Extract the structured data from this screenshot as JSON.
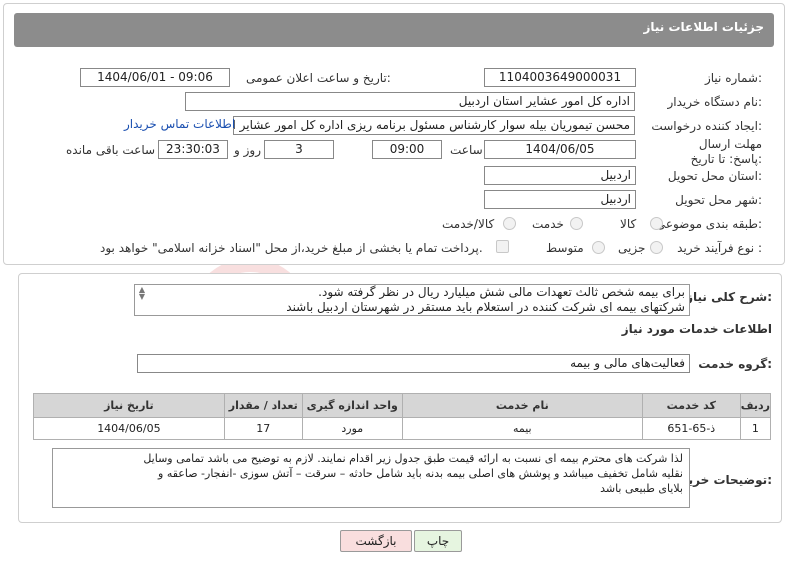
{
  "header": {
    "title": "جزئیات اطلاعات نیاز"
  },
  "fields": {
    "need_number_label": "شماره نیاز:",
    "need_number": "1104003649000031",
    "announce_label": "تاریخ و ساعت اعلان عمومی:",
    "announce_value": "1404/06/01 - 09:06",
    "buyer_org_label": "نام دستگاه خریدار:",
    "buyer_org": "اداره کل امور عشایر استان اردبیل",
    "creator_label": "ایجاد کننده درخواست:",
    "creator": "محسن تیموریان بیله سوار کارشناس مسئول برنامه ریزی اداره کل امور عشایر اس",
    "contact_link": "اطلاعات تماس خریدار",
    "deadline_label": "مهلت ارسال پاسخ: تا تاریخ:",
    "deadline_date": "1404/06/05",
    "time_label": "ساعت",
    "deadline_time": "09:00",
    "days_value": "3",
    "days_label": "روز و",
    "remaining_time": "23:30:03",
    "remaining_label": "ساعت باقی مانده",
    "province_label": "استان محل تحویل:",
    "province": "اردبیل",
    "city_label": "شهر محل تحویل:",
    "city": "اردبیل",
    "category_label": "طبقه بندی موضوعی:",
    "category_options": [
      "کالا",
      "خدمت",
      "کالا/خدمت"
    ],
    "category_selected": "خدمت",
    "process_label": "نوع فرآیند خرید :",
    "process_options": [
      "جزیی",
      "متوسط"
    ],
    "process_selected": "جزیی",
    "payment_note": "پرداخت تمام یا بخشی از مبلغ خرید،از محل \"اسناد خزانه اسلامی\" خواهد بود."
  },
  "description": {
    "label": "شرح کلی نیاز:",
    "line1": "برای بیمه شخص ثالث تعهدات مالی شش میلیارد ریال در نظر گرفته شود.",
    "line2": "شرکتهای بیمه ای شرکت کننده در استعلام باید مستقر در شهرستان اردبیل باشند"
  },
  "services": {
    "section_title": "اطلاعات خدمات مورد نیاز",
    "group_label": "گروه خدمت:",
    "group_value": "فعالیت‌های مالی و بیمه",
    "columns": [
      "ردیف",
      "کد خدمت",
      "نام خدمت",
      "واحد اندازه گیری",
      "تعداد / مقدار",
      "تاریخ نیاز"
    ],
    "rows": [
      {
        "row": "1",
        "code": "ذ-65-651",
        "name": "بیمه",
        "unit": "مورد",
        "qty": "17",
        "date": "1404/06/05"
      }
    ]
  },
  "buyer_notes": {
    "label": "توضیحات خریدار:",
    "line1": "لذا شرکت های محترم  بیمه ای نسبت  به ارائه قیمت طبق جدول زیر اقدام نمایند. لازم به توضیح می باشد تمامی وسایل",
    "line2": "نقلیه شامل تخفیف  میباشد و  پوشش های اصلی بیمه بدنه باید شامل حادثه – سرقت – آتش سوزی -انفجار- صاعقه و",
    "line3": "بلایای طبیعی باشد"
  },
  "buttons": {
    "print": "چاپ",
    "back": "بازگشت"
  },
  "colors": {
    "header_bg": "#8c8c8c",
    "link": "#1a4fb0",
    "back_btn": "#f9dede",
    "print_btn": "#e6f5e0"
  }
}
